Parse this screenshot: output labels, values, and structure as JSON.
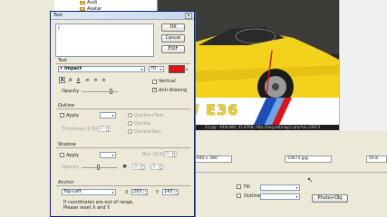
{
  "tree": {
    "items": [
      "Audi",
      "Avatar"
    ]
  },
  "photo": {
    "watermark_text": "W E36",
    "status_text": "23.jpg - 640x380, 41.87KB, http://img.data.bg/1.php?id=33673"
  },
  "info": {
    "dimensions": "640 x 380",
    "id_value": "33673.jpg",
    "extra": "56.8"
  },
  "lower_panel": {
    "fill_label": "Fill",
    "outline_label": "Outline",
    "photo_button": "Photo+Obj"
  },
  "dialog": {
    "title": "Text",
    "close_glyph": "×",
    "text_value": "/",
    "buttons": {
      "ok": "OK",
      "cancel": "Cancel",
      "exif": "EXIF"
    },
    "text_group": {
      "label": "Text",
      "font": "Impact",
      "size": "70",
      "color": "#e0121a",
      "vertical_label": "Vertical",
      "antialiasing_label": "Anti Aliasing",
      "opacity_label": "Opacity",
      "opacity_fraction": 0.82
    },
    "outline_group": {
      "label": "Outline",
      "apply_label": "Apply",
      "thickness_label": "Thickness (1-50)",
      "thickness_value": "2",
      "radio_outline_text": "Outline+Text",
      "radio_outline": "Outline",
      "radio_outline_text_2": "Outline-Text"
    },
    "shadow_group": {
      "label": "Shadow",
      "apply_label": "Apply",
      "blur_label": "Blur (0-5)",
      "blur_value": "0",
      "opacity_label": "Opacity",
      "x_value": "3",
      "y_value": "3",
      "opacity_fraction": 0.45
    },
    "anchor_group": {
      "label": "Anchor",
      "position": "Top-Left",
      "x_label": "X",
      "x_value": "293",
      "y_label": "Y",
      "y_value": "143",
      "note_line1": "If coordinates are out of range,",
      "note_line2": "Please reset X and Y."
    }
  },
  "colors": {
    "accent_red": "#e0121a",
    "title_bar": "#c8d8ee",
    "car_yellow": "#f2d21a"
  }
}
